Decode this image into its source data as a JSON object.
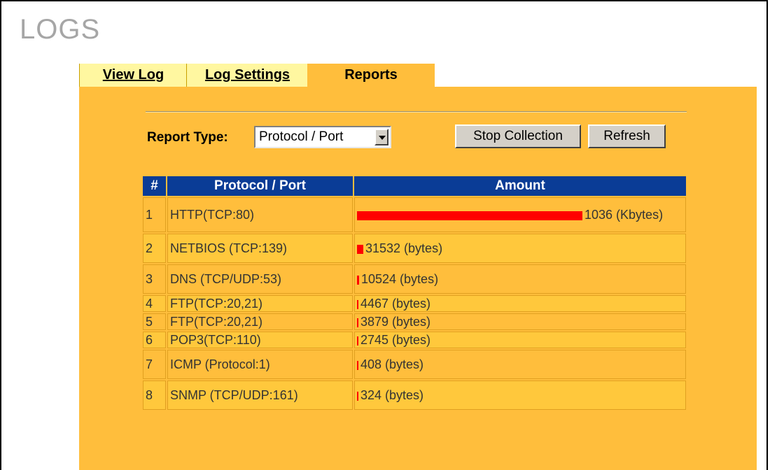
{
  "page": {
    "title": "LOGS"
  },
  "tabs": [
    {
      "label": "View Log",
      "active": false
    },
    {
      "label": "Log Settings",
      "active": false
    },
    {
      "label": "Reports",
      "active": true
    }
  ],
  "controls": {
    "report_type_label": "Report Type:",
    "report_type_value": "Protocol / Port",
    "stop_button": "Stop Collection",
    "refresh_button": "Refresh"
  },
  "table": {
    "headers": [
      "#",
      "Protocol / Port",
      "Amount"
    ],
    "rows": [
      {
        "num": "1",
        "protocol": "HTTP(TCP:80)",
        "amount": "1036 (Kbytes)",
        "bar_fraction": 1.0
      },
      {
        "num": "2",
        "protocol": "NETBIOS (TCP:139)",
        "amount": "31532 (bytes)",
        "bar_fraction": 0.028
      },
      {
        "num": "3",
        "protocol": "DNS (TCP/UDP:53)",
        "amount": "10524 (bytes)",
        "bar_fraction": 0.01
      },
      {
        "num": "4",
        "protocol": "FTP(TCP:20,21)",
        "amount": "4467 (bytes)",
        "bar_fraction": 0.005
      },
      {
        "num": "5",
        "protocol": "FTP(TCP:20,21)",
        "amount": "3879 (bytes)",
        "bar_fraction": 0.005
      },
      {
        "num": "6",
        "protocol": "POP3(TCP:110)",
        "amount": "2745 (bytes)",
        "bar_fraction": 0.005
      },
      {
        "num": "7",
        "protocol": "ICMP (Protocol:1)",
        "amount": "408 (bytes)",
        "bar_fraction": 0.005
      },
      {
        "num": "8",
        "protocol": "SNMP (TCP/UDP:161)",
        "amount": "324 (bytes)",
        "bar_fraction": 0.005
      }
    ]
  },
  "colors": {
    "panel_bg": "#ffbe3c",
    "tab_bg": "#fff7a0",
    "header_bg": "#0a3c96",
    "bar": "#ff0000",
    "title": "#a6a6a6"
  }
}
